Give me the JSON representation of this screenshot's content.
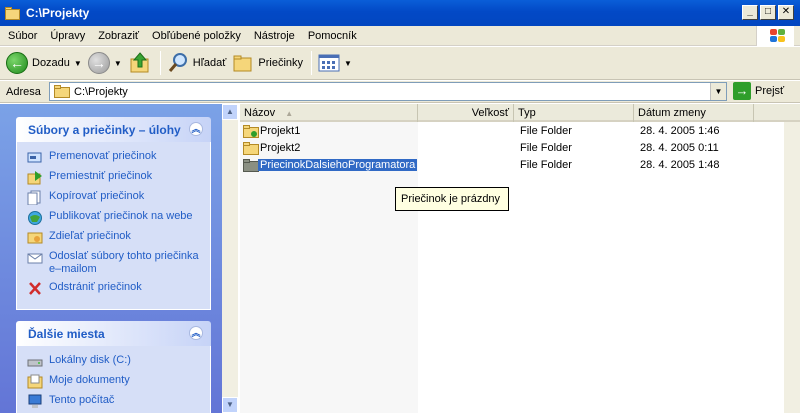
{
  "window": {
    "title": "C:\\Projekty"
  },
  "titlebar_buttons": {
    "minimize": "_",
    "maximize": "□",
    "close": "✕"
  },
  "menu": [
    "Súbor",
    "Úpravy",
    "Zobraziť",
    "Obľúbené položky",
    "Nástroje",
    "Pomocník"
  ],
  "toolbar": {
    "back_label": "Dozadu",
    "search_label": "Hľadať",
    "folders_label": "Priečinky"
  },
  "address": {
    "label": "Adresa",
    "value": "C:\\Projekty",
    "go_label": "Prejsť"
  },
  "tasks_panel": {
    "title": "Súbory a priečinky – úlohy",
    "items": [
      {
        "label": "Premenovať priečinok",
        "icon": "rename-icon"
      },
      {
        "label": "Premiestniť priečinok",
        "icon": "move-icon"
      },
      {
        "label": "Kopírovať priečinok",
        "icon": "copy-icon"
      },
      {
        "label": "Publikovať priečinok na webe",
        "icon": "web-publish-icon"
      },
      {
        "label": "Zdieľať priečinok",
        "icon": "share-icon"
      },
      {
        "label": "Odoslať súbory tohto priečinka e–mailom",
        "icon": "email-icon"
      },
      {
        "label": "Odstrániť priečinok",
        "icon": "delete-icon"
      }
    ]
  },
  "places_panel": {
    "title": "Ďalšie miesta",
    "items": [
      {
        "label": "Lokálny disk (C:)",
        "icon": "drive-icon"
      },
      {
        "label": "Moje dokumenty",
        "icon": "documents-icon"
      },
      {
        "label": "Tento počítač",
        "icon": "computer-icon"
      }
    ]
  },
  "columns": [
    "Názov",
    "Veľkosť",
    "Typ",
    "Dátum zmeny"
  ],
  "files": [
    {
      "name": "Projekt1",
      "size": "",
      "type": "File Folder",
      "modified": "28. 4. 2005 1:46",
      "selected": false
    },
    {
      "name": "Projekt2",
      "size": "",
      "type": "File Folder",
      "modified": "28. 4. 2005 0:11",
      "selected": false
    },
    {
      "name": "PriecinokDalsiehoProgramatora",
      "size": "",
      "type": "File Folder",
      "modified": "28. 4. 2005 1:48",
      "selected": true
    }
  ],
  "tooltip": "Priečinok je prázdny",
  "colors": {
    "titlebar": "#0a5ed8",
    "task_link": "#215dc6",
    "selection": "#316ac5",
    "tooltip_bg": "#ffffe1"
  }
}
